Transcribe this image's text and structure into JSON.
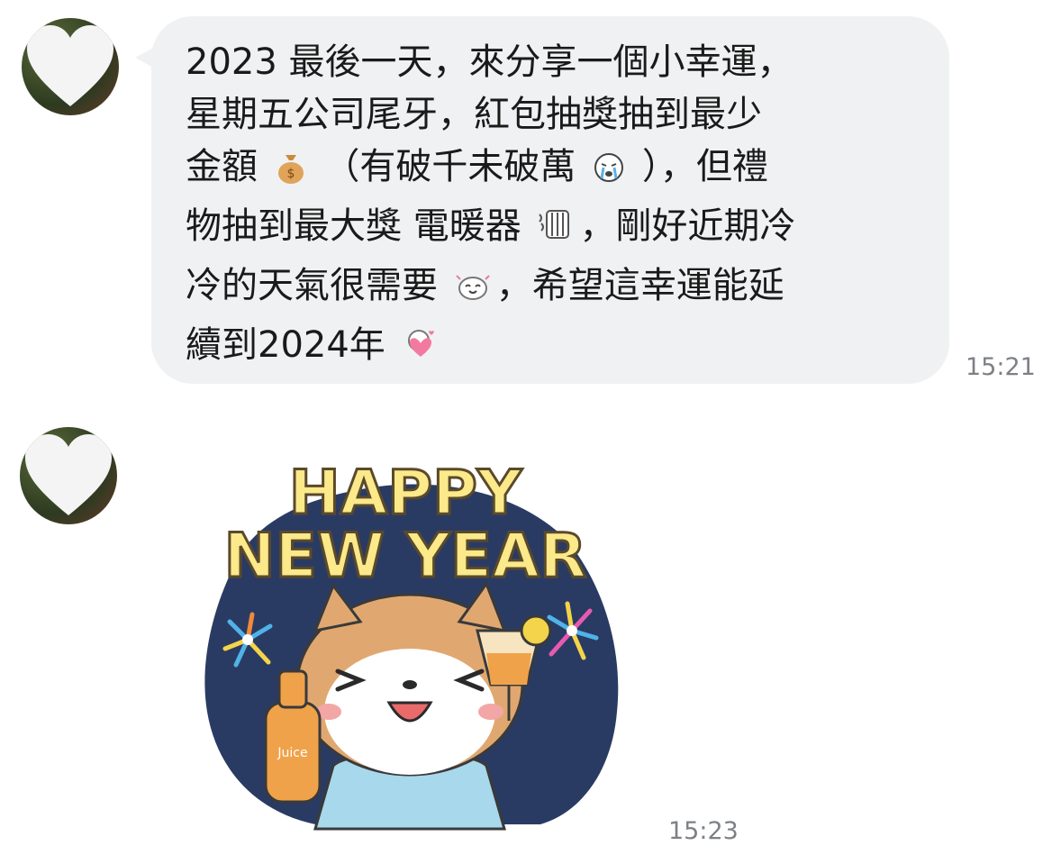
{
  "messages": [
    {
      "lines": [
        [
          "2023 最後一天，來分享一個小幸運，"
        ],
        [
          "星期五公司尾牙，紅包抽獎抽到最少"
        ],
        [
          "金額 ",
          {
            "icon": "money-bag-icon"
          },
          " （有破千未破萬 ",
          {
            "icon": "crying-emoji-icon"
          },
          " ），但禮"
        ],
        [
          "物抽到最大獎 電暖器 ",
          {
            "icon": "heater-icon"
          },
          "，剛好近期冷"
        ],
        [
          "冷的天氣很需要 ",
          {
            "icon": "happy-emoji-icon"
          },
          "，希望這幸運能延"
        ],
        [
          "續到2024年 ",
          {
            "icon": "heart-emoji-icon"
          }
        ]
      ],
      "time": "15:21"
    },
    {
      "sticker": {
        "line1": "HAPPY",
        "line2": "NEW YEAR",
        "bottle_label": "Juice"
      },
      "time": "15:23"
    }
  ],
  "colors": {
    "bubble": "#f0f1f3",
    "time": "#7d8185",
    "sticker_bg": "#2a3b63",
    "sticker_text": "#fbe98a"
  }
}
